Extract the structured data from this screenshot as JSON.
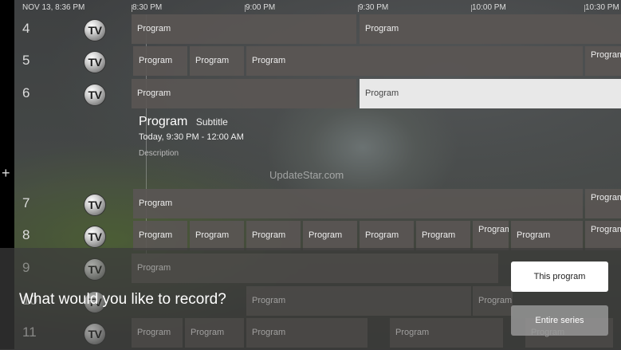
{
  "header": {
    "datetime": "NOV 13, 8:36 PM",
    "times": [
      "8:30 PM",
      "9:00 PM",
      "9:30 PM",
      "10:00 PM",
      "10:30 PM"
    ]
  },
  "channel_logo_text": "TV",
  "channels": [
    {
      "number": "4",
      "programs": [
        "Program",
        "Program"
      ]
    },
    {
      "number": "5",
      "programs": [
        "Program",
        "Program",
        "Program",
        "Program"
      ]
    },
    {
      "number": "6",
      "programs": [
        "Program",
        "Program"
      ]
    },
    {
      "number": "7",
      "programs": [
        "Program",
        "Program"
      ]
    },
    {
      "number": "8",
      "programs": [
        "Program",
        "Program",
        "Program",
        "Program",
        "Program",
        "Program",
        "Program",
        "Program",
        "Program"
      ]
    },
    {
      "number": "9",
      "programs": [
        "Program"
      ]
    },
    {
      "number": "10",
      "programs": [
        "Program",
        "Program"
      ]
    },
    {
      "number": "11",
      "programs": [
        "Program",
        "Program",
        "Program",
        "Program",
        "Program"
      ]
    }
  ],
  "selected_program": {
    "title": "Program",
    "subtitle": "Subtitle",
    "time": "Today, 9:30 PM - 12:00 AM",
    "description": "Description"
  },
  "watermark": "UpdateStar.com",
  "record_dialog": {
    "prompt": "What would you like to record?",
    "this_program_label": "This program",
    "entire_series_label": "Entire series"
  },
  "side_icon": "plus-icon"
}
